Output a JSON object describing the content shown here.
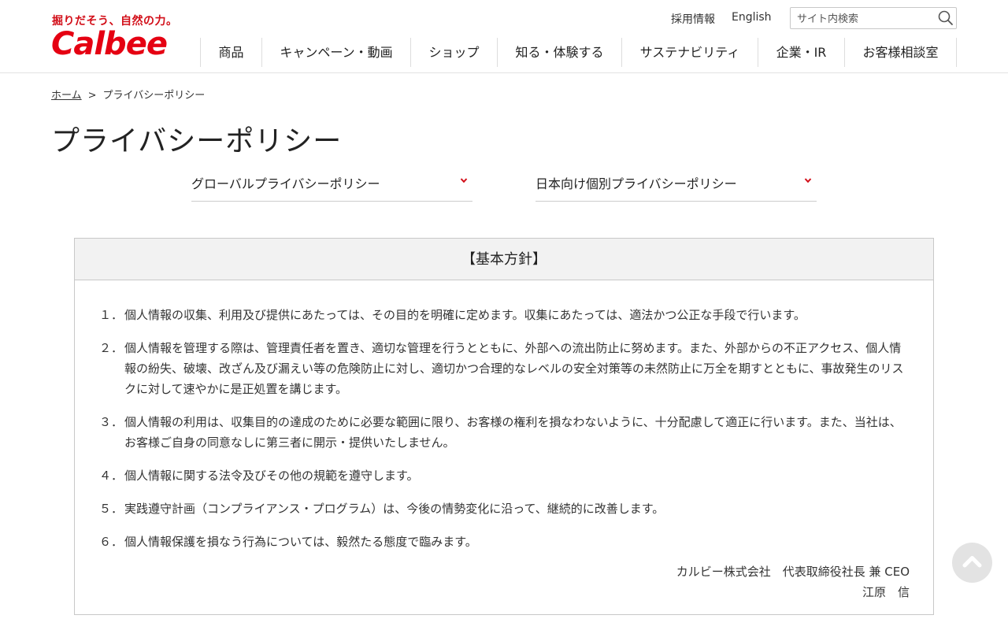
{
  "header": {
    "tagline": "掘りだそう、自然の力。",
    "logo_text": "Calbee",
    "utility_links": [
      "採用情報",
      "English"
    ],
    "search": {
      "placeholder": "サイト内検索",
      "value": ""
    },
    "nav": [
      "商品",
      "キャンペーン・動画",
      "ショップ",
      "知る・体験する",
      "サステナビリティ",
      "企業・IR",
      "お客様相談室"
    ]
  },
  "breadcrumb": {
    "home": "ホーム",
    "separator": ">",
    "current": "プライバシーポリシー"
  },
  "page_title": "プライバシーポリシー",
  "dropdowns": [
    "グローバルプライバシーポリシー",
    "日本向け個別プライバシーポリシー"
  ],
  "policy": {
    "heading": "【基本方針】",
    "items": [
      {
        "num": "１．",
        "text": "個人情報の収集、利用及び提供にあたっては、その目的を明確に定めます。収集にあたっては、適法かつ公正な手段で行います。"
      },
      {
        "num": "２．",
        "text": "個人情報を管理する際は、管理責任者を置き、適切な管理を行うとともに、外部への流出防止に努めます。また、外部からの不正アクセス、個人情報の紛失、破壊、改ざん及び漏えい等の危険防止に対し、適切かつ合理的なレベルの安全対策等の未然防止に万全を期すとともに、事故発生のリスクに対して速やかに是正処置を講じます。"
      },
      {
        "num": "３．",
        "text": "個人情報の利用は、収集目的の達成のために必要な範囲に限り、お客様の権利を損なわないように、十分配慮して適正に行います。また、当社は、お客様ご自身の同意なしに第三者に開示・提供いたしません。"
      },
      {
        "num": "４．",
        "text": "個人情報に関する法令及びその他の規範を遵守します。"
      },
      {
        "num": "５．",
        "text": "実践遵守計画（コンプライアンス・プログラム）は、今後の情勢変化に沿って、継続的に改善します。"
      },
      {
        "num": "６．",
        "text": "個人情報保護を損なう行為については、毅然たる態度で臨みます。"
      }
    ],
    "signature_line1": "カルビー株式会社　代表取締役社長 兼 CEO",
    "signature_line2": "江原　信"
  },
  "colors": {
    "brand_red": "#e50012",
    "accent_chevron": "#d20e18"
  }
}
